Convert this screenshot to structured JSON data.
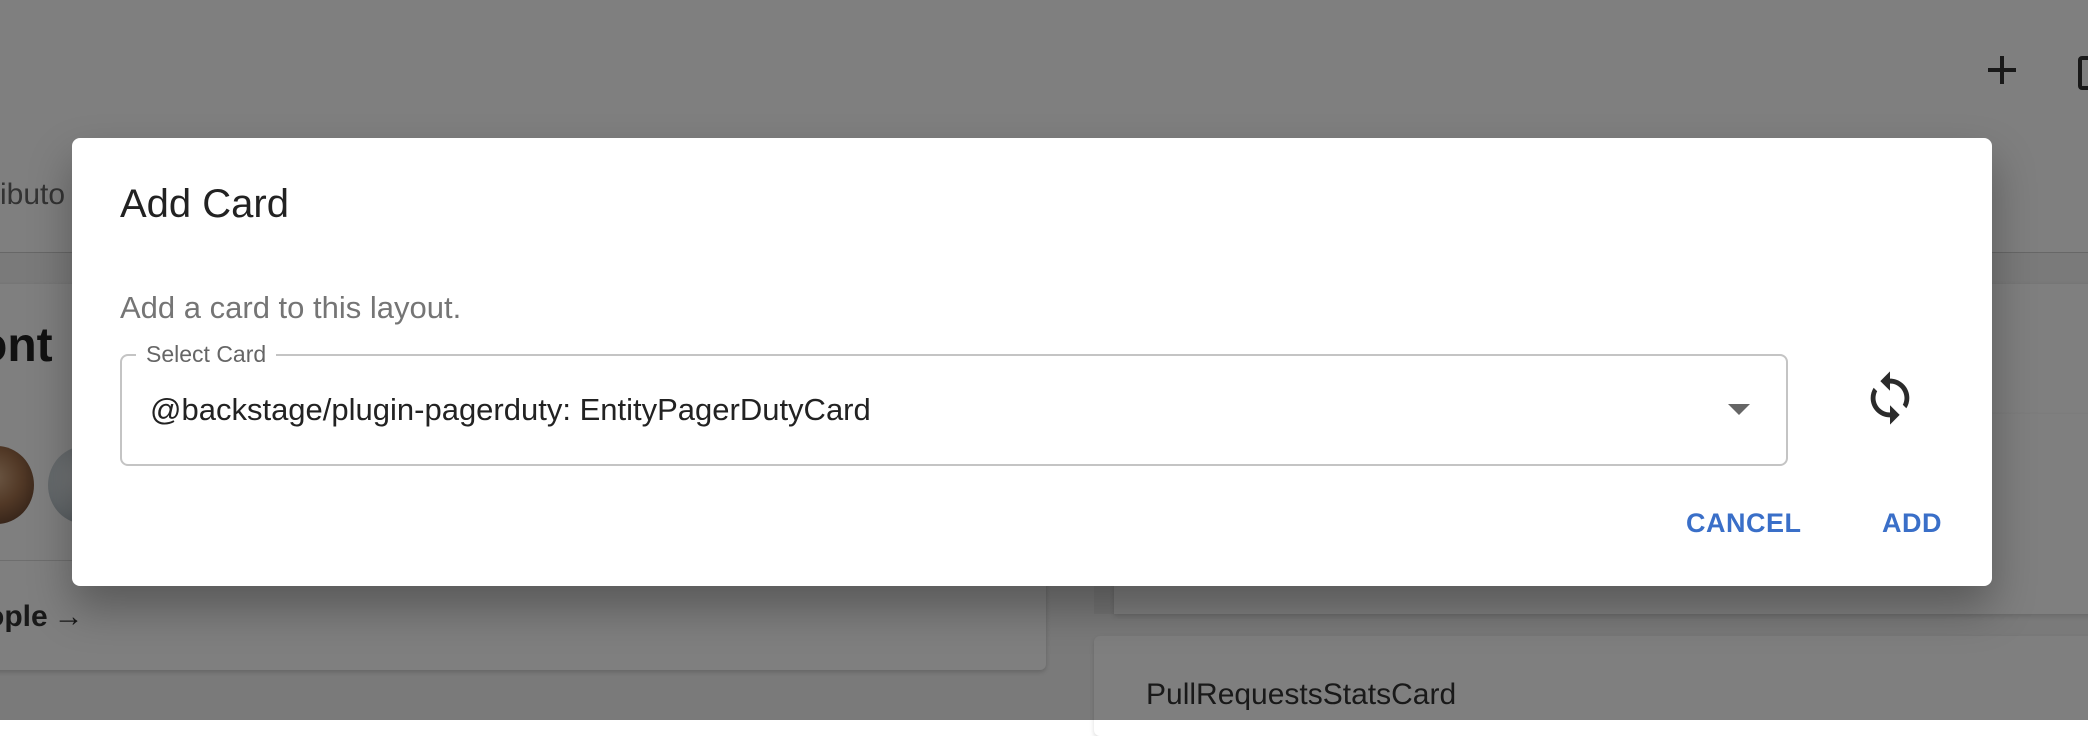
{
  "background": {
    "tab_partial_label": "ributo",
    "card_title_partial": "ont",
    "people_link_partial": "ople",
    "people_link_arrow": "→",
    "right_card_title": "PullRequestsStatsCard"
  },
  "dialog": {
    "title": "Add Card",
    "description": "Add a card to this layout.",
    "select": {
      "label": "Select Card",
      "value": "@backstage/plugin-pagerduty: EntityPagerDutyCard"
    },
    "refresh_icon": "refresh-icon",
    "cancel_label": "CANCEL",
    "add_label": "ADD"
  },
  "colors": {
    "accent": "#3a6fc8",
    "backdrop": "rgba(0,0,0,0.5)"
  }
}
